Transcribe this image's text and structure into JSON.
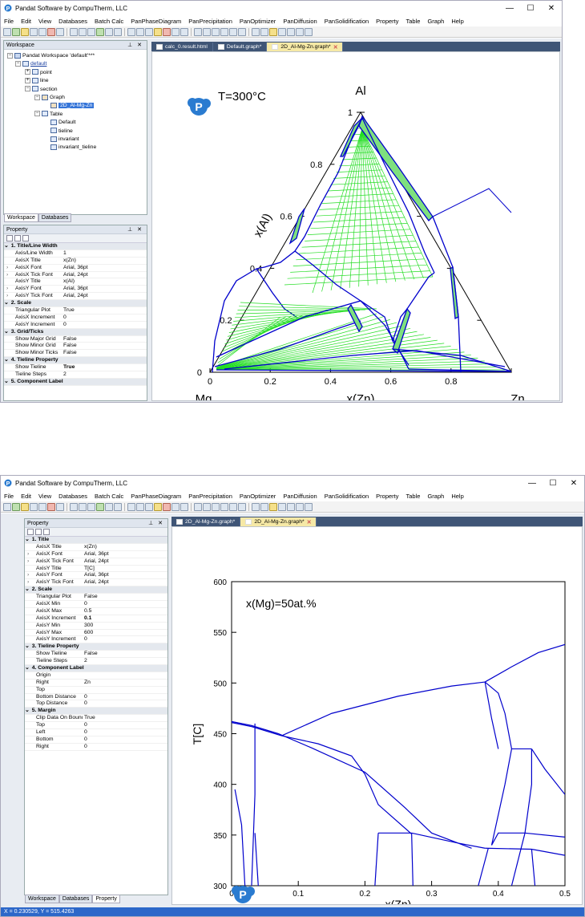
{
  "app_title": "Pandat Software by CompuTherm, LLC",
  "menu": [
    "File",
    "Edit",
    "View",
    "Databases",
    "Batch Calc",
    "PanPhaseDiagram",
    "PanPrecipitation",
    "PanOptimizer",
    "PanDiffusion",
    "PanSolidification",
    "Property",
    "Table",
    "Graph",
    "Help"
  ],
  "window_controls": {
    "min": "—",
    "max": "☐",
    "close": "✕"
  },
  "top": {
    "workspace_title": "Workspace",
    "tree": {
      "root": "Pandat Workspace 'default'***",
      "default": "default",
      "point": "point",
      "line": "line",
      "section": "section",
      "graph": "Graph",
      "graph_item": "2D_Al-Mg-Zn",
      "table": "Table",
      "table_items": [
        "Default",
        "tieline",
        "invariant",
        "invariant_tieline"
      ]
    },
    "bottom_tabs": [
      "Workspace",
      "Databases"
    ],
    "property_title": "Property",
    "props": [
      {
        "cat": true,
        "k": "1. Title/Line Width"
      },
      {
        "k": "Axis/Line Width",
        "v": "1"
      },
      {
        "k": "AxisX Title",
        "v": "x(Zn)"
      },
      {
        "k": "AxisX Font",
        "v": "Arial, 36pt",
        "sub": true
      },
      {
        "k": "AxisX Tick Font",
        "v": "Arial, 24pt",
        "sub": true
      },
      {
        "k": "AxisY Title",
        "v": "x(Al)"
      },
      {
        "k": "AxisY Font",
        "v": "Arial, 36pt",
        "sub": true
      },
      {
        "k": "AxisY Tick Font",
        "v": "Arial, 24pt",
        "sub": true
      },
      {
        "cat": true,
        "k": "2. Scale"
      },
      {
        "k": "Triangular Plot",
        "v": "True"
      },
      {
        "k": "AxisX Increment",
        "v": "0"
      },
      {
        "k": "AxisY Increment",
        "v": "0"
      },
      {
        "cat": true,
        "k": "3. Grid/Ticks"
      },
      {
        "k": "Show Major Grid",
        "v": "False"
      },
      {
        "k": "Show Minor Grid",
        "v": "False"
      },
      {
        "k": "Show Minor Ticks",
        "v": "False"
      },
      {
        "cat": true,
        "k": "4. Tieline Property"
      },
      {
        "k": "Show Tieline",
        "v": "True",
        "bold": true
      },
      {
        "k": "Tieline Steps",
        "v": "2"
      },
      {
        "cat": true,
        "k": "5. Component Label"
      }
    ],
    "tabs": [
      {
        "label": "calc_0.result.html",
        "active": false
      },
      {
        "label": "Default.graph*",
        "active": false
      },
      {
        "label": "2D_Al-Mg-Zn.graph*",
        "active": true
      }
    ],
    "chart_data": {
      "type": "scatter",
      "subtype": "ternary isothermal section",
      "annotation": "T=300°C",
      "corners": {
        "top": "Al",
        "left": "Mg",
        "right": "Zn"
      },
      "xlabel": "x(Zn)",
      "ylabel": "x(Al)",
      "x_ticks": [
        "0",
        "0.2",
        "0.4",
        "0.6",
        "0.8"
      ],
      "y_ticks": [
        "0",
        "0.2",
        "0.4",
        "0.6",
        "0.8",
        "1"
      ],
      "colors": {
        "phase_boundary": "#0000cc",
        "tieline": "#22dd22"
      }
    }
  },
  "bottom": {
    "property_title": "Property",
    "props": [
      {
        "cat": true,
        "k": "1. Title"
      },
      {
        "k": "AxisX Title",
        "v": "x(Zn)"
      },
      {
        "k": "AxisX Font",
        "v": "Arial, 36pt",
        "sub": true
      },
      {
        "k": "AxisX Tick Font",
        "v": "Arial, 24pt",
        "sub": true
      },
      {
        "k": "AxisY Title",
        "v": "T[C]"
      },
      {
        "k": "AxisY Font",
        "v": "Arial, 36pt",
        "sub": true
      },
      {
        "k": "AxisY Tick Font",
        "v": "Arial, 24pt",
        "sub": true
      },
      {
        "cat": true,
        "k": "2. Scale"
      },
      {
        "k": "Triangular Plot",
        "v": "False"
      },
      {
        "k": "AxisX Min",
        "v": "0"
      },
      {
        "k": "AxisX Max",
        "v": "0.5"
      },
      {
        "k": "AxisX Increment",
        "v": "0.1",
        "bold": true
      },
      {
        "k": "AxisY Min",
        "v": "300"
      },
      {
        "k": "AxisY Max",
        "v": "600"
      },
      {
        "k": "AxisY Increment",
        "v": "0"
      },
      {
        "cat": true,
        "k": "3. Tieline Property"
      },
      {
        "k": "Show Tieline",
        "v": "False"
      },
      {
        "k": "Tieline Steps",
        "v": "2"
      },
      {
        "cat": true,
        "k": "4. Component Label"
      },
      {
        "k": "Origin",
        "v": ""
      },
      {
        "k": "Right",
        "v": "Zn"
      },
      {
        "k": "Top",
        "v": ""
      },
      {
        "k": "Bottom Distance",
        "v": "0"
      },
      {
        "k": "Top Distance",
        "v": "0"
      },
      {
        "cat": true,
        "k": "5. Margin"
      },
      {
        "k": "Clip Data On Bounds",
        "v": "True"
      },
      {
        "k": "Top",
        "v": "0"
      },
      {
        "k": "Left",
        "v": "0"
      },
      {
        "k": "Bottom",
        "v": "0"
      },
      {
        "k": "Right",
        "v": "0"
      }
    ],
    "bottom_tabs": [
      "Workspace",
      "Databases",
      "Property"
    ],
    "tabs": [
      {
        "label": "2D_Al-Mg-Zn.graph*",
        "active": false
      },
      {
        "label": "2D_Al-Mg-Zn.graph*",
        "active": true
      }
    ],
    "status": "X = 0.230529, Y = 515.4263",
    "chart_data": {
      "type": "line",
      "subtype": "isopleth",
      "annotation": "x(Mg)=50at.%",
      "xlabel": "x(Zn)",
      "ylabel": "T[C]",
      "xlim": [
        0,
        0.5
      ],
      "ylim": [
        300,
        600
      ],
      "x_ticks": [
        "0",
        "0.1",
        "0.2",
        "0.3",
        "0.4",
        "0.5"
      ],
      "y_ticks": [
        "300",
        "350",
        "400",
        "450",
        "500",
        "550",
        "600"
      ],
      "colors": {
        "line": "#0000cc"
      },
      "series": [
        {
          "x": [
            0,
            0.03,
            0.07,
            0.12,
            0.2,
            0.26,
            0.3,
            0.36
          ],
          "y": [
            462,
            458,
            450,
            436,
            412,
            377,
            352,
            337
          ]
        },
        {
          "x": [
            0.075,
            0.15,
            0.25,
            0.33,
            0.38
          ],
          "y": [
            448,
            470,
            487,
            497,
            501
          ]
        },
        {
          "x": [
            0.38,
            0.42,
            0.46,
            0.5
          ],
          "y": [
            501,
            516,
            530,
            538
          ]
        },
        {
          "x": [
            0,
            0.03,
            0.075
          ],
          "y": [
            461,
            457,
            448
          ]
        },
        {
          "x": [
            0.075,
            0.13,
            0.18,
            0.2,
            0.22,
            0.27
          ],
          "y": [
            448,
            440,
            428,
            410,
            380,
            351
          ]
        },
        {
          "x": [
            0.22,
            0.27
          ],
          "y": [
            352,
            352
          ]
        },
        {
          "x": [
            0.27,
            0.34,
            0.38
          ],
          "y": [
            352,
            342,
            337
          ]
        },
        {
          "x": [
            0.38,
            0.45,
            0.5
          ],
          "y": [
            337,
            336,
            330
          ]
        },
        {
          "x": [
            0.38,
            0.4,
            0.41,
            0.42
          ],
          "y": [
            501,
            490,
            470,
            435
          ]
        },
        {
          "x": [
            0.42,
            0.45
          ],
          "y": [
            435,
            435
          ]
        },
        {
          "x": [
            0.45,
            0.47,
            0.5
          ],
          "y": [
            435,
            415,
            390
          ]
        },
        {
          "x": [
            0.42,
            0.41,
            0.4,
            0.39
          ],
          "y": [
            435,
            400,
            370,
            340
          ]
        },
        {
          "x": [
            0.39,
            0.4,
            0.44,
            0.5
          ],
          "y": [
            340,
            352,
            352,
            348
          ]
        },
        {
          "x": [
            0.45,
            0.45,
            0.44
          ],
          "y": [
            435,
            400,
            352
          ]
        },
        {
          "x": [
            0.38,
            0.39,
            0.4
          ],
          "y": [
            501,
            465,
            435
          ]
        },
        {
          "x": [
            0.005,
            0.015,
            0.02
          ],
          "y": [
            395,
            360,
            300
          ]
        },
        {
          "x": [
            0.035,
            0.035,
            0.03
          ],
          "y": [
            460,
            390,
            300
          ]
        },
        {
          "x": [
            0.035,
            0.04
          ],
          "y": [
            352,
            300
          ]
        },
        {
          "x": [
            0.22,
            0.215
          ],
          "y": [
            352,
            300
          ]
        },
        {
          "x": [
            0.27,
            0.272
          ],
          "y": [
            352,
            300
          ]
        },
        {
          "x": [
            0.385,
            0.37
          ],
          "y": [
            337,
            300
          ]
        },
        {
          "x": [
            0.44,
            0.42
          ],
          "y": [
            352,
            300
          ]
        },
        {
          "x": [
            0.45,
            0.455
          ],
          "y": [
            336,
            300
          ]
        }
      ]
    }
  }
}
